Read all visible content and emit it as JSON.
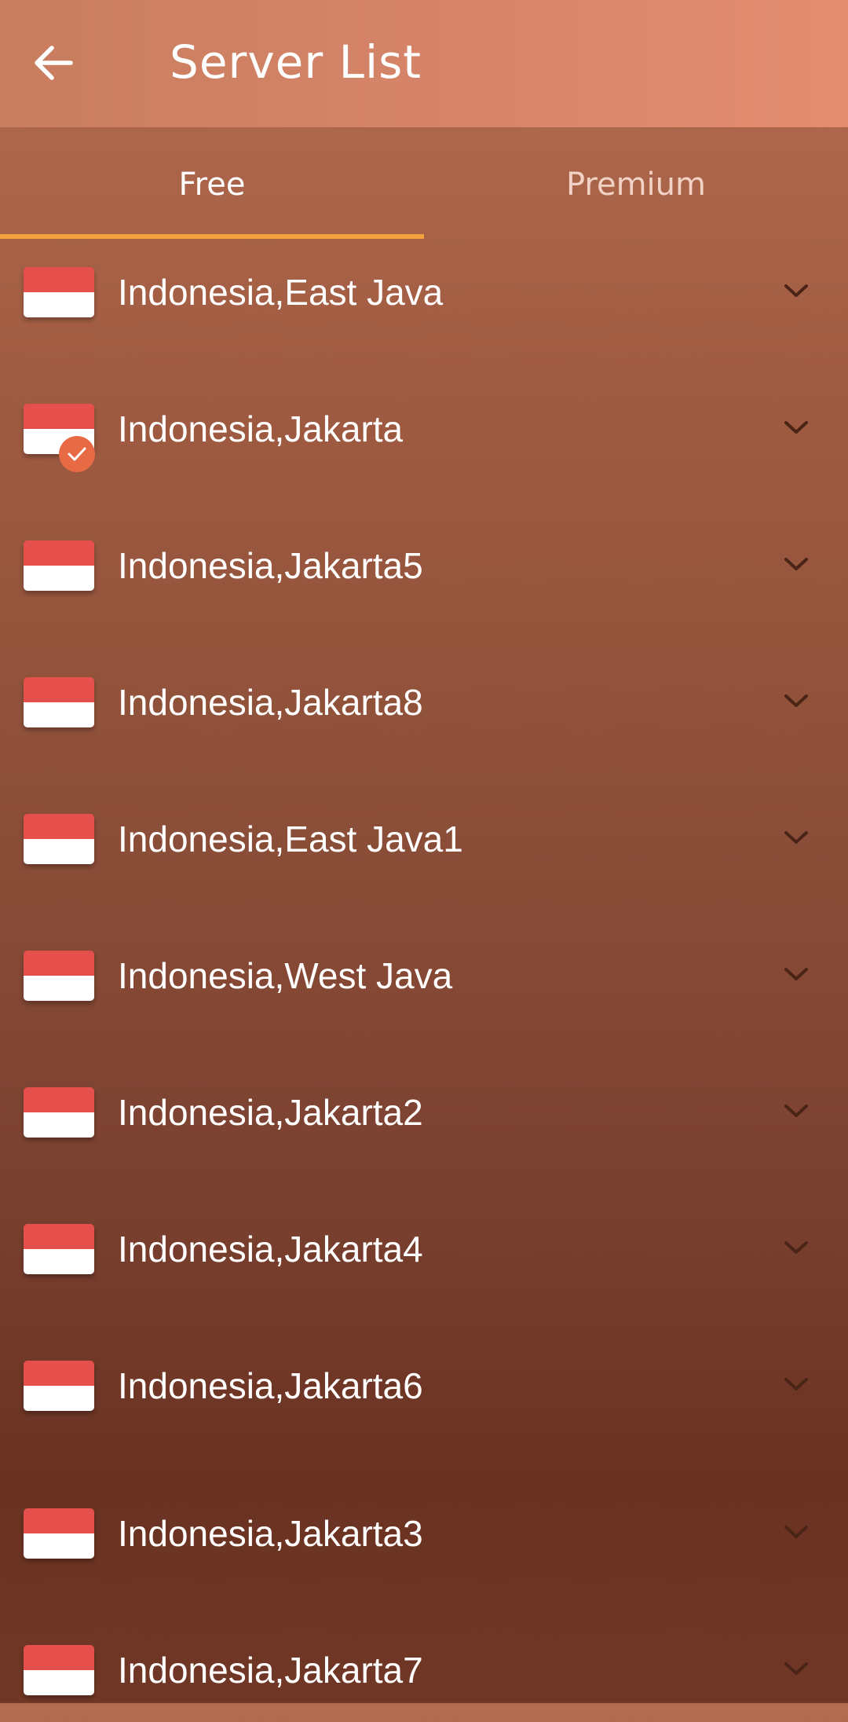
{
  "header": {
    "title": "Server List",
    "back_icon": "arrow-left-icon"
  },
  "tabs": [
    {
      "label": "Free",
      "selected": true
    },
    {
      "label": "Premium",
      "selected": false
    }
  ],
  "colors": {
    "tab_indicator": "#f3a13e",
    "selected_check": "#e86a45",
    "flag_red": "#e5504c",
    "flag_white": "#ffffff"
  },
  "servers": [
    {
      "name": "Indonesia,East Java",
      "flag": "indonesia-flag-icon",
      "selected": false
    },
    {
      "name": "Indonesia,Jakarta",
      "flag": "indonesia-flag-icon",
      "selected": true
    },
    {
      "name": "Indonesia,Jakarta5",
      "flag": "indonesia-flag-icon",
      "selected": false
    },
    {
      "name": "Indonesia,Jakarta8",
      "flag": "indonesia-flag-icon",
      "selected": false
    },
    {
      "name": "Indonesia,East Java1",
      "flag": "indonesia-flag-icon",
      "selected": false
    },
    {
      "name": "Indonesia,West Java",
      "flag": "indonesia-flag-icon",
      "selected": false
    },
    {
      "name": "Indonesia,Jakarta2",
      "flag": "indonesia-flag-icon",
      "selected": false
    },
    {
      "name": "Indonesia,Jakarta4",
      "flag": "indonesia-flag-icon",
      "selected": false
    },
    {
      "name": "Indonesia,Jakarta6",
      "flag": "indonesia-flag-icon",
      "selected": false
    },
    {
      "name": "Indonesia,Jakarta3",
      "flag": "indonesia-flag-icon",
      "selected": false
    },
    {
      "name": "Indonesia,Jakarta7",
      "flag": "indonesia-flag-icon",
      "selected": false
    }
  ]
}
